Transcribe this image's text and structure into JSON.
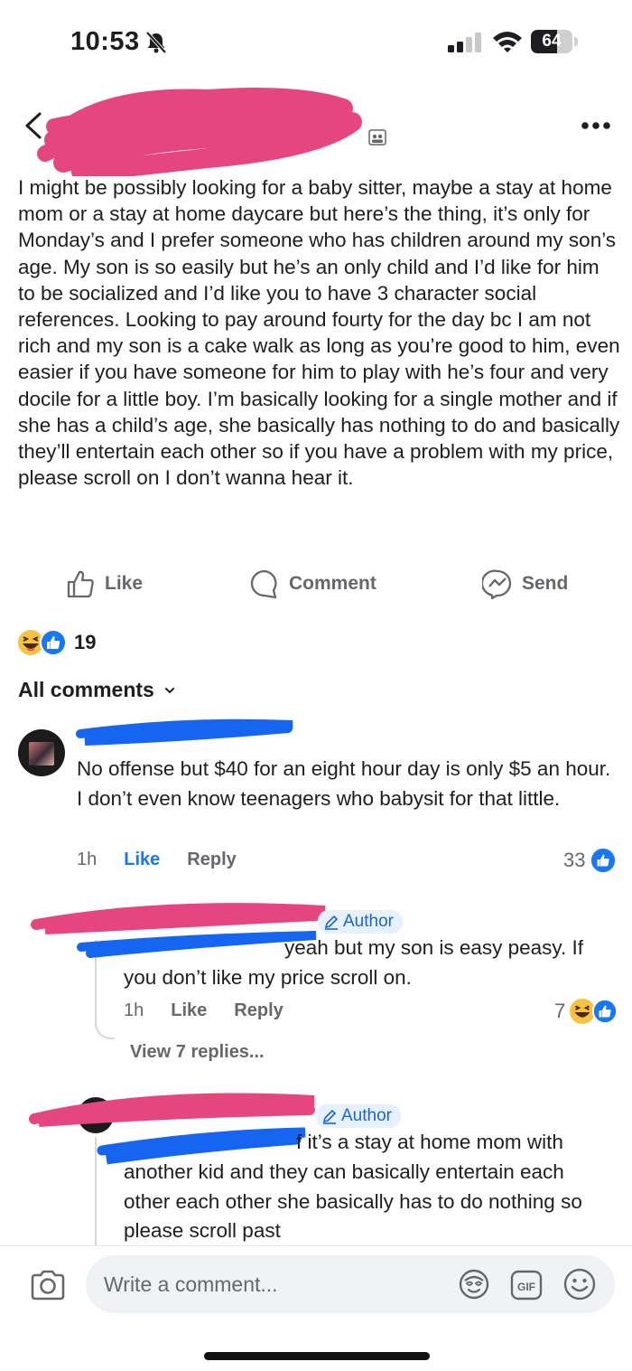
{
  "status_bar": {
    "time": "10:53",
    "battery_level": "64",
    "battery_fraction": 0.64
  },
  "post": {
    "text": "I might be possibly looking for a baby sitter, maybe a stay at home mom or a stay at home daycare but here’s the thing, it’s only for Monday’s and I prefer someone who has children around my son’s age. My son is so easily but he’s an only child and I’d like for him to be socialized and I’d like you to have 3 character social references. Looking to pay around fourty for the day bc I am not rich and my son is a cake walk as long as you’re good to him, even easier if you have someone for him to play with he’s four and very docile for a little boy. I’m basically looking for a single mother and if she has a child’s age, she basically has nothing to do and basically they’ll entertain each other so if you have a problem with my price, please scroll on I don’t wanna hear it.",
    "actions": {
      "like": "Like",
      "comment": "Comment",
      "send": "Send"
    },
    "reaction_count": "19"
  },
  "comments_filter": "All comments",
  "comments": [
    {
      "text": "No offense but $40 for an eight hour day is only $5 an hour. I don’t even know teenagers who babysit for that little.",
      "time": "1h",
      "like_label": "Like",
      "reply_label": "Reply",
      "reaction_count": "33"
    },
    {
      "author_badge": "Author",
      "text": "yeah but my son is easy peasy. If you don’t like my price scroll on.",
      "time": "1h",
      "like_label": "Like",
      "reply_label": "Reply",
      "reaction_count": "7",
      "view_replies": "View 7 replies..."
    },
    {
      "author_badge": "Author",
      "text_line1": "f it’s a stay at home mom with",
      "text_rest": "another kid and they can basically entertain each other each other she basically has to do nothing so please scroll past"
    }
  ],
  "composer": {
    "placeholder": "Write a comment...",
    "gif_label": "GIF"
  },
  "colors": {
    "facebook_blue": "#1877f2",
    "redaction_pink": "#e5467f",
    "redaction_blue": "#1565f0",
    "secondary_text": "#65676b"
  }
}
